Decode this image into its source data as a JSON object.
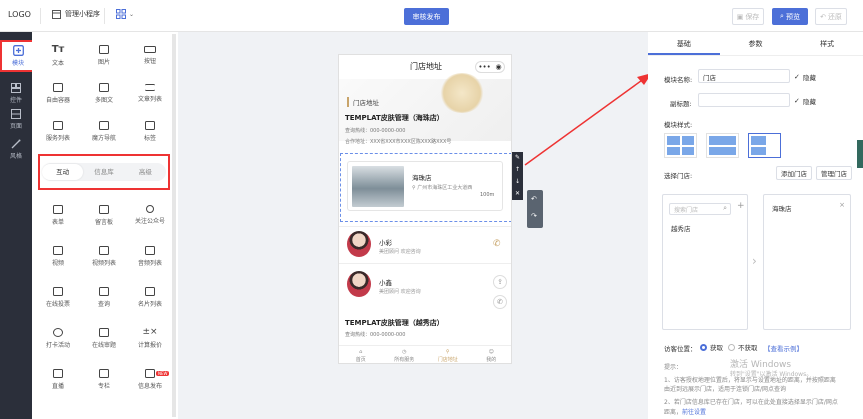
{
  "topbar": {
    "logo": "LOGO",
    "mini_program": "管理小程序",
    "publish": "审核发布",
    "save": "保存",
    "preview": "预览",
    "restore": "还原"
  },
  "leftnav": [
    {
      "label": "模块",
      "icon": "plus-square-icon"
    },
    {
      "label": "控件",
      "icon": "controls-icon"
    },
    {
      "label": "页面",
      "icon": "page-icon"
    },
    {
      "label": "风格",
      "icon": "magic-wand-icon"
    }
  ],
  "modules_top": [
    "文本",
    "图片",
    "按钮",
    "自由容器",
    "多图文",
    "文章列表",
    "服务列表",
    "魔方导航",
    "标签"
  ],
  "module_tabs": [
    "互动",
    "信息库",
    "高级"
  ],
  "modules_interact": [
    "表单",
    "留言板",
    "关注公众号",
    "视频",
    "视频列表",
    "音频列表",
    "在线投票",
    "查询",
    "名片列表",
    "打卡活动",
    "在线审题",
    "计算报价",
    "直播",
    "专栏",
    "信息发布"
  ],
  "new_badge": "NEW",
  "phone": {
    "title": "门店地址",
    "capsule": "•••",
    "section_title": "门店地址",
    "store1": {
      "name": "TEMPLAT皮肤管理（海珠店）",
      "phone": "查询热线：000-0000-000",
      "address": "合作地址：XXX省XXX市XXX区陈XXX路XXX号"
    },
    "card": {
      "name": "海珠店",
      "address": "广州市海珠区工业大道西",
      "distance": "100m"
    },
    "staff": [
      {
        "name": "小彩",
        "sub": "美团顾问 欢迎咨询"
      },
      {
        "name": "小鑫",
        "sub": "美团顾问 欢迎咨询"
      }
    ],
    "store2_name": "TEMPLAT皮肤管理（越秀店）",
    "tabbar": [
      "首页",
      "所有服务",
      "门店地址",
      "我的"
    ]
  },
  "right": {
    "tabs": [
      "基础",
      "参数",
      "样式"
    ],
    "module_name_label": "模块名称:",
    "module_name_value": "门店",
    "hide_label": "隐藏",
    "subtitle_label": "副标题:",
    "style_label": "模块样式:",
    "select_store_label": "选择门店:",
    "add_store": "添加门店",
    "manage_store": "管理门店",
    "search_placeholder": "搜索门店",
    "left_item": "越秀店",
    "right_item": "海珠店",
    "location_label": "访客位置：",
    "get": "获取",
    "not_get": "不获取",
    "view_example": "【查看示例】",
    "tip_title": "提示：",
    "tip1": "1、访客授权地理位置后，将显示与设置地址的距离，并按照距离",
    "tip1b": "由近到远展示门店，适用于连锁门店/网点查询",
    "tip2": "2、若门店信息库已存在门店，可以在此处直接选择显示门店/网点",
    "tip2b_a": "距离，",
    "tip2b_link": "前往设置"
  },
  "watermark": "激活 Windows",
  "watermark2": "转到\"设置\"以激活 Windows。"
}
